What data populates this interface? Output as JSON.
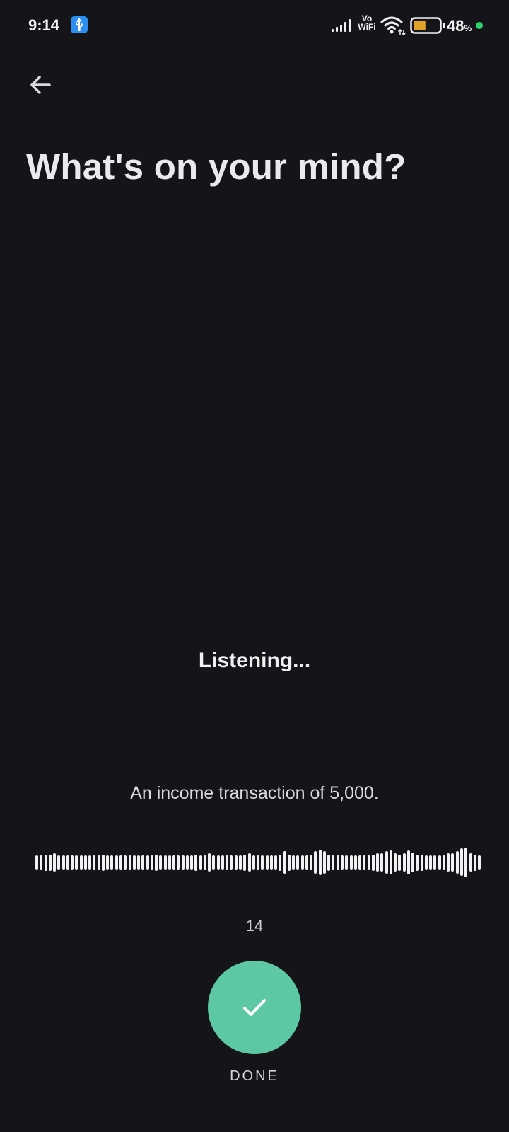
{
  "status_bar": {
    "time": "9:14",
    "network_label_top": "Vo",
    "network_label_bottom": "WiFi",
    "battery_percent": "48",
    "battery_unit": "%",
    "battery_level": 0.48,
    "battery_color": "#e0a227",
    "icons": [
      "usb-icon",
      "signal-icon",
      "wifi-icon",
      "battery-icon",
      "charging-dot-icon"
    ]
  },
  "header": {
    "back_icon": "arrow-left-icon",
    "title": "What's on your mind?"
  },
  "recording": {
    "status": "Listening...",
    "transcript": "An income transaction of 5,000.",
    "timer": "14",
    "waveform_levels": [
      0.45,
      0.45,
      0.5,
      0.5,
      0.55,
      0.45,
      0.45,
      0.45,
      0.45,
      0.45,
      0.45,
      0.45,
      0.45,
      0.45,
      0.45,
      0.5,
      0.45,
      0.45,
      0.45,
      0.45,
      0.45,
      0.45,
      0.45,
      0.45,
      0.45,
      0.45,
      0.45,
      0.5,
      0.45,
      0.45,
      0.45,
      0.45,
      0.45,
      0.45,
      0.45,
      0.45,
      0.5,
      0.45,
      0.45,
      0.55,
      0.45,
      0.45,
      0.45,
      0.45,
      0.45,
      0.45,
      0.45,
      0.5,
      0.55,
      0.45,
      0.45,
      0.45,
      0.45,
      0.45,
      0.45,
      0.5,
      0.7,
      0.5,
      0.45,
      0.45,
      0.45,
      0.45,
      0.45,
      0.7,
      0.8,
      0.7,
      0.5,
      0.45,
      0.45,
      0.45,
      0.45,
      0.45,
      0.45,
      0.45,
      0.45,
      0.45,
      0.5,
      0.55,
      0.55,
      0.7,
      0.75,
      0.55,
      0.5,
      0.55,
      0.75,
      0.6,
      0.5,
      0.5,
      0.45,
      0.45,
      0.45,
      0.45,
      0.45,
      0.55,
      0.55,
      0.7,
      0.85,
      0.9,
      0.55,
      0.5,
      0.45
    ]
  },
  "actions": {
    "done_icon": "checkmark-icon",
    "done_label": "DONE",
    "accent_color": "#5cc9a4"
  }
}
